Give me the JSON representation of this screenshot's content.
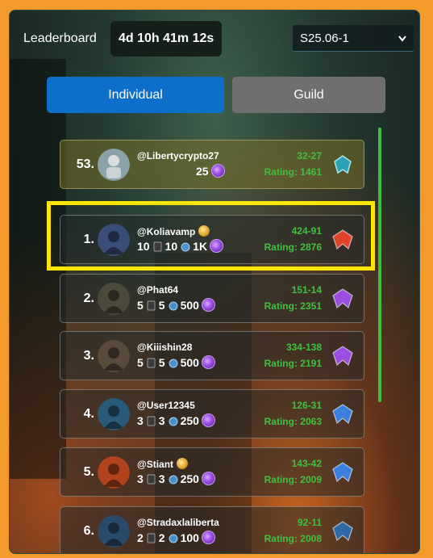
{
  "header": {
    "title": "Leaderboard",
    "timer": "4d 10h 41m 12s",
    "season": "S25.06-1"
  },
  "tabs": [
    {
      "label": "Individual",
      "active": true
    },
    {
      "label": "Guild",
      "active": false
    }
  ],
  "colors": {
    "accent": "#0d6fc9",
    "record_green": "#3fc13f",
    "highlight": "#ffe600",
    "frame": "#f39a2b"
  },
  "my_entry": {
    "rank": "53.",
    "username": "@Libertycrypto27",
    "gems": "25",
    "record": "32-27",
    "rating": "Rating: 1461",
    "avatar_icon": "robot-avatar-icon",
    "badge_icon": "teal-rank-badge-icon"
  },
  "entries": [
    {
      "rank": "1.",
      "username": "@Koliavamp",
      "crown": true,
      "a": "10",
      "b": "10",
      "gems": "1K",
      "record": "424-91",
      "rating": "Rating: 2876",
      "badge_color": "#e2442b",
      "avatar_color": "#3a4d78"
    },
    {
      "rank": "2.",
      "username": "@Phat64",
      "crown": false,
      "a": "5",
      "b": "5",
      "gems": "500",
      "record": "151-14",
      "rating": "Rating: 2351",
      "badge_color": "#9a4de0",
      "avatar_color": "#4b4a3a"
    },
    {
      "rank": "3.",
      "username": "@Kiiishin28",
      "crown": false,
      "a": "5",
      "b": "5",
      "gems": "500",
      "record": "334-138",
      "rating": "Rating: 2191",
      "badge_color": "#9a4de0",
      "avatar_color": "#5a4a3a"
    },
    {
      "rank": "4.",
      "username": "@User12345",
      "crown": false,
      "a": "3",
      "b": "3",
      "gems": "250",
      "record": "126-31",
      "rating": "Rating: 2063",
      "badge_color": "#3b7fe0",
      "avatar_color": "#2a5a7a"
    },
    {
      "rank": "5.",
      "username": "@Stiant",
      "crown": true,
      "a": "3",
      "b": "3",
      "gems": "250",
      "record": "143-42",
      "rating": "Rating: 2009",
      "badge_color": "#3b7fe0",
      "avatar_color": "#b0421c"
    },
    {
      "rank": "6.",
      "username": "@Stradaxlaliberta",
      "crown": false,
      "a": "2",
      "b": "2",
      "gems": "100",
      "record": "92-11",
      "rating": "Rating: 2008",
      "badge_color": "#2f6aa8",
      "avatar_color": "#2a4a6a"
    }
  ]
}
